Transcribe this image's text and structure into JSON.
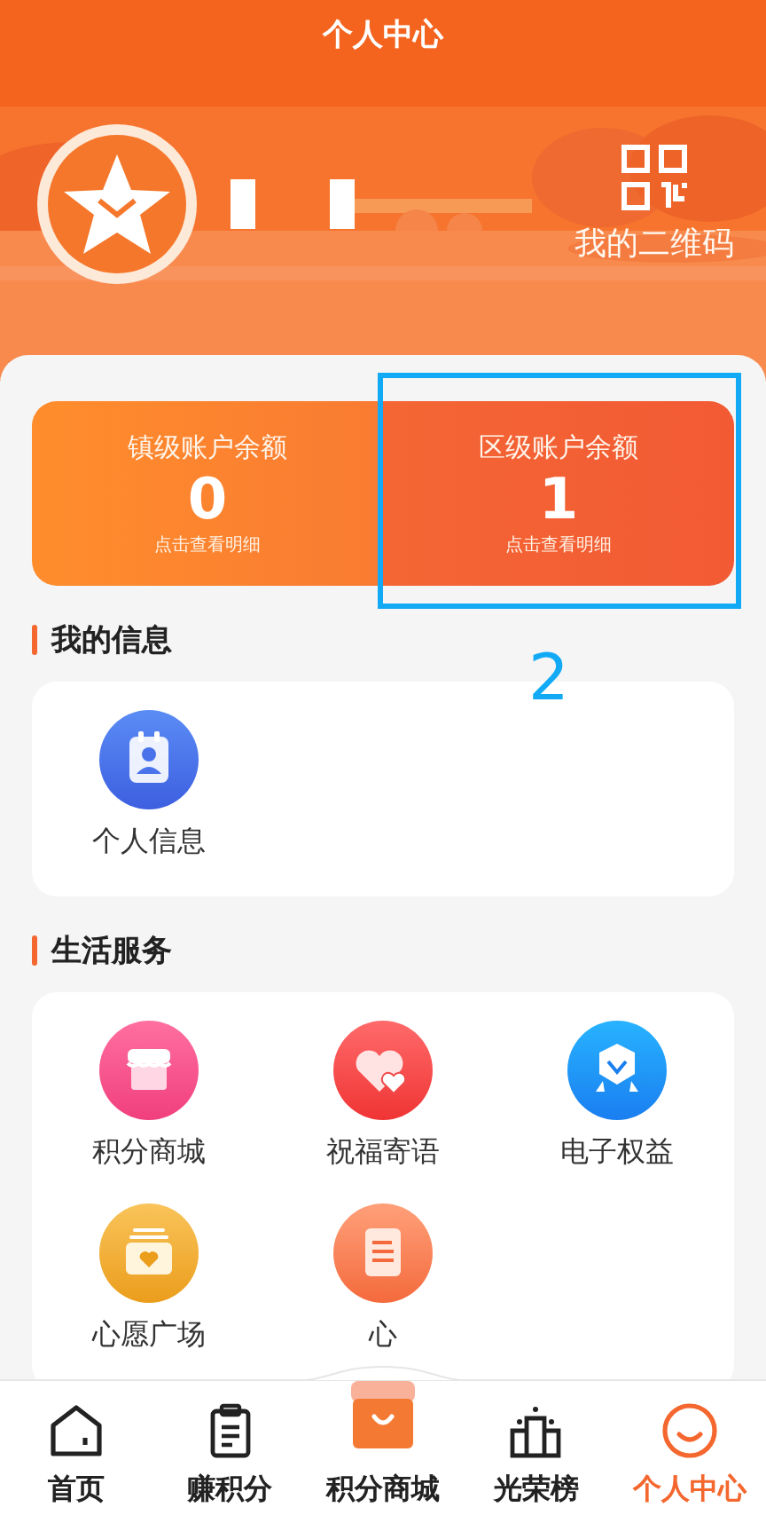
{
  "header": {
    "title": "个人中心",
    "qr_label": "我的二维码"
  },
  "accounts": [
    {
      "label": "镇级账户余额",
      "amount": "0",
      "hint": "点击查看明细",
      "highlighted": false
    },
    {
      "label": "区级账户余额",
      "amount": "1",
      "hint": "点击查看明细",
      "highlighted": true
    }
  ],
  "annotation": {
    "label": "2"
  },
  "sections": [
    {
      "title": "我的信息",
      "items": [
        {
          "label": "个人信息",
          "kind": "person"
        }
      ]
    },
    {
      "title": "生活服务",
      "items": [
        {
          "label": "积分商城",
          "kind": "shop"
        },
        {
          "label": "祝福寄语",
          "kind": "hearts"
        },
        {
          "label": "电子权益",
          "kind": "badge"
        },
        {
          "label": "心愿广场",
          "kind": "wish"
        },
        {
          "label": "心",
          "kind": "note"
        }
      ]
    }
  ],
  "tabbar": [
    {
      "label": "首页",
      "kind": "home",
      "selected": false
    },
    {
      "label": "赚积分",
      "kind": "clipboard",
      "selected": false
    },
    {
      "label": "积分商城",
      "kind": "bag",
      "selected": false
    },
    {
      "label": "光荣榜",
      "kind": "podium",
      "selected": false
    },
    {
      "label": "个人中心",
      "kind": "smile",
      "selected": true
    }
  ]
}
